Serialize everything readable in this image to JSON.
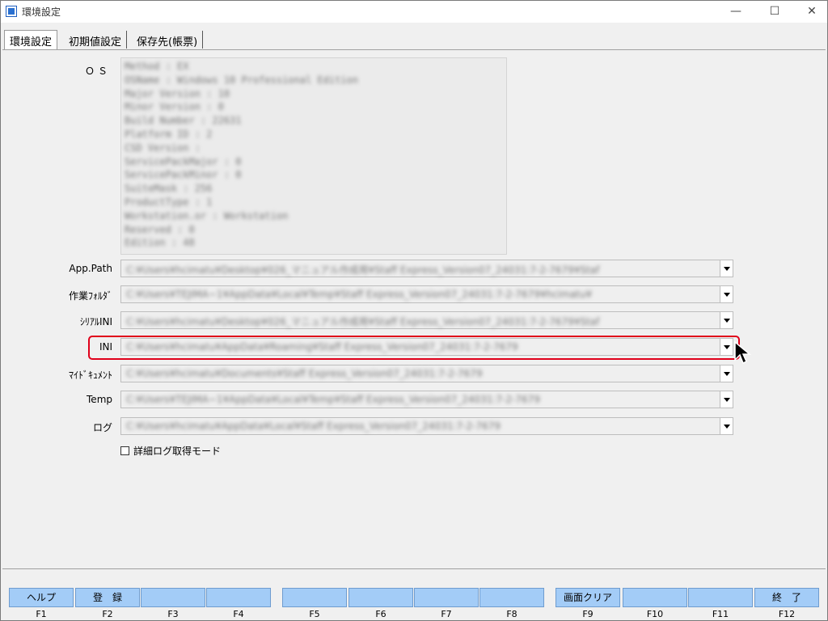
{
  "window": {
    "title": "環境設定",
    "minimize": "—",
    "maximize": "☐",
    "close": "✕"
  },
  "tabs": [
    {
      "label": "環境設定"
    },
    {
      "label": "初期値設定"
    },
    {
      "label": "保存先(帳票)"
    }
  ],
  "os": {
    "label": "ＯＳ",
    "lines": [
      "Method          : EX",
      "OSName          : Windows 10 Professional Edition",
      "Major Version   : 10",
      "Minor Version   : 0",
      "Build Number    : 22631",
      "Platform ID     : 2",
      "CSD Version     :",
      "ServicePackMajor : 0",
      "ServicePackMinor : 0",
      "SuiteMask       : 256",
      "ProductType     : 1",
      "Workstation.or  : Workstation",
      "Reserved        : 0",
      "Edition         : 48"
    ]
  },
  "fields": [
    {
      "label": "App.Path",
      "value": "C:¥Users¥hcimatu¥Desktop¥026_マニュアル作成用¥Staff Express_Version07_24031:7-2-7679¥Staf"
    },
    {
      "label": "作業ﾌｫﾙﾀﾞ",
      "value": "C:¥Users¥TEJIMA~1¥AppData¥Local¥Temp¥Staff Express_Version07_24031:7-2-7679¥hcimatu¥"
    },
    {
      "label": "ｼﾘｱﾙINI",
      "value": "C:¥Users¥hcimatu¥Desktop¥026_マニュアル作成用¥Staff Express_Version07_24031:7-2-7679¥Staf"
    },
    {
      "label": "INI",
      "value": "C:¥Users¥hcimatu¥AppData¥Roaming¥Staff Express_Version07_24031:7-2-7679"
    },
    {
      "label": "ﾏｲﾄﾞｷｭﾒﾝﾄ",
      "value": "C:¥Users¥hcimatu¥Documents¥Staff Express_Version07_24031:7-2-7679"
    },
    {
      "label": "Temp",
      "value": "C:¥Users¥TEJIMA~1¥AppData¥Local¥Temp¥Staff Express_Version07_24031:7-2-7679"
    },
    {
      "label": "ログ",
      "value": "C:¥Users¥hcimatu¥AppData¥Local¥Staff Express_Version07_24031:7-2-7679"
    }
  ],
  "detail_log": {
    "label": "詳細ログ取得モード",
    "checked": false
  },
  "fkeys": [
    {
      "key": "F1",
      "label": "ヘルプ"
    },
    {
      "key": "F2",
      "label": "登　録"
    },
    {
      "key": "F3",
      "label": ""
    },
    {
      "key": "F4",
      "label": ""
    },
    {
      "key": "F5",
      "label": ""
    },
    {
      "key": "F6",
      "label": ""
    },
    {
      "key": "F7",
      "label": ""
    },
    {
      "key": "F8",
      "label": ""
    },
    {
      "key": "F9",
      "label": "画面クリア"
    },
    {
      "key": "F10",
      "label": ""
    },
    {
      "key": "F11",
      "label": ""
    },
    {
      "key": "F12",
      "label": "終　了"
    }
  ],
  "colors": {
    "highlight": "#e0001a",
    "fkey_bg": "#a3ccf7"
  }
}
